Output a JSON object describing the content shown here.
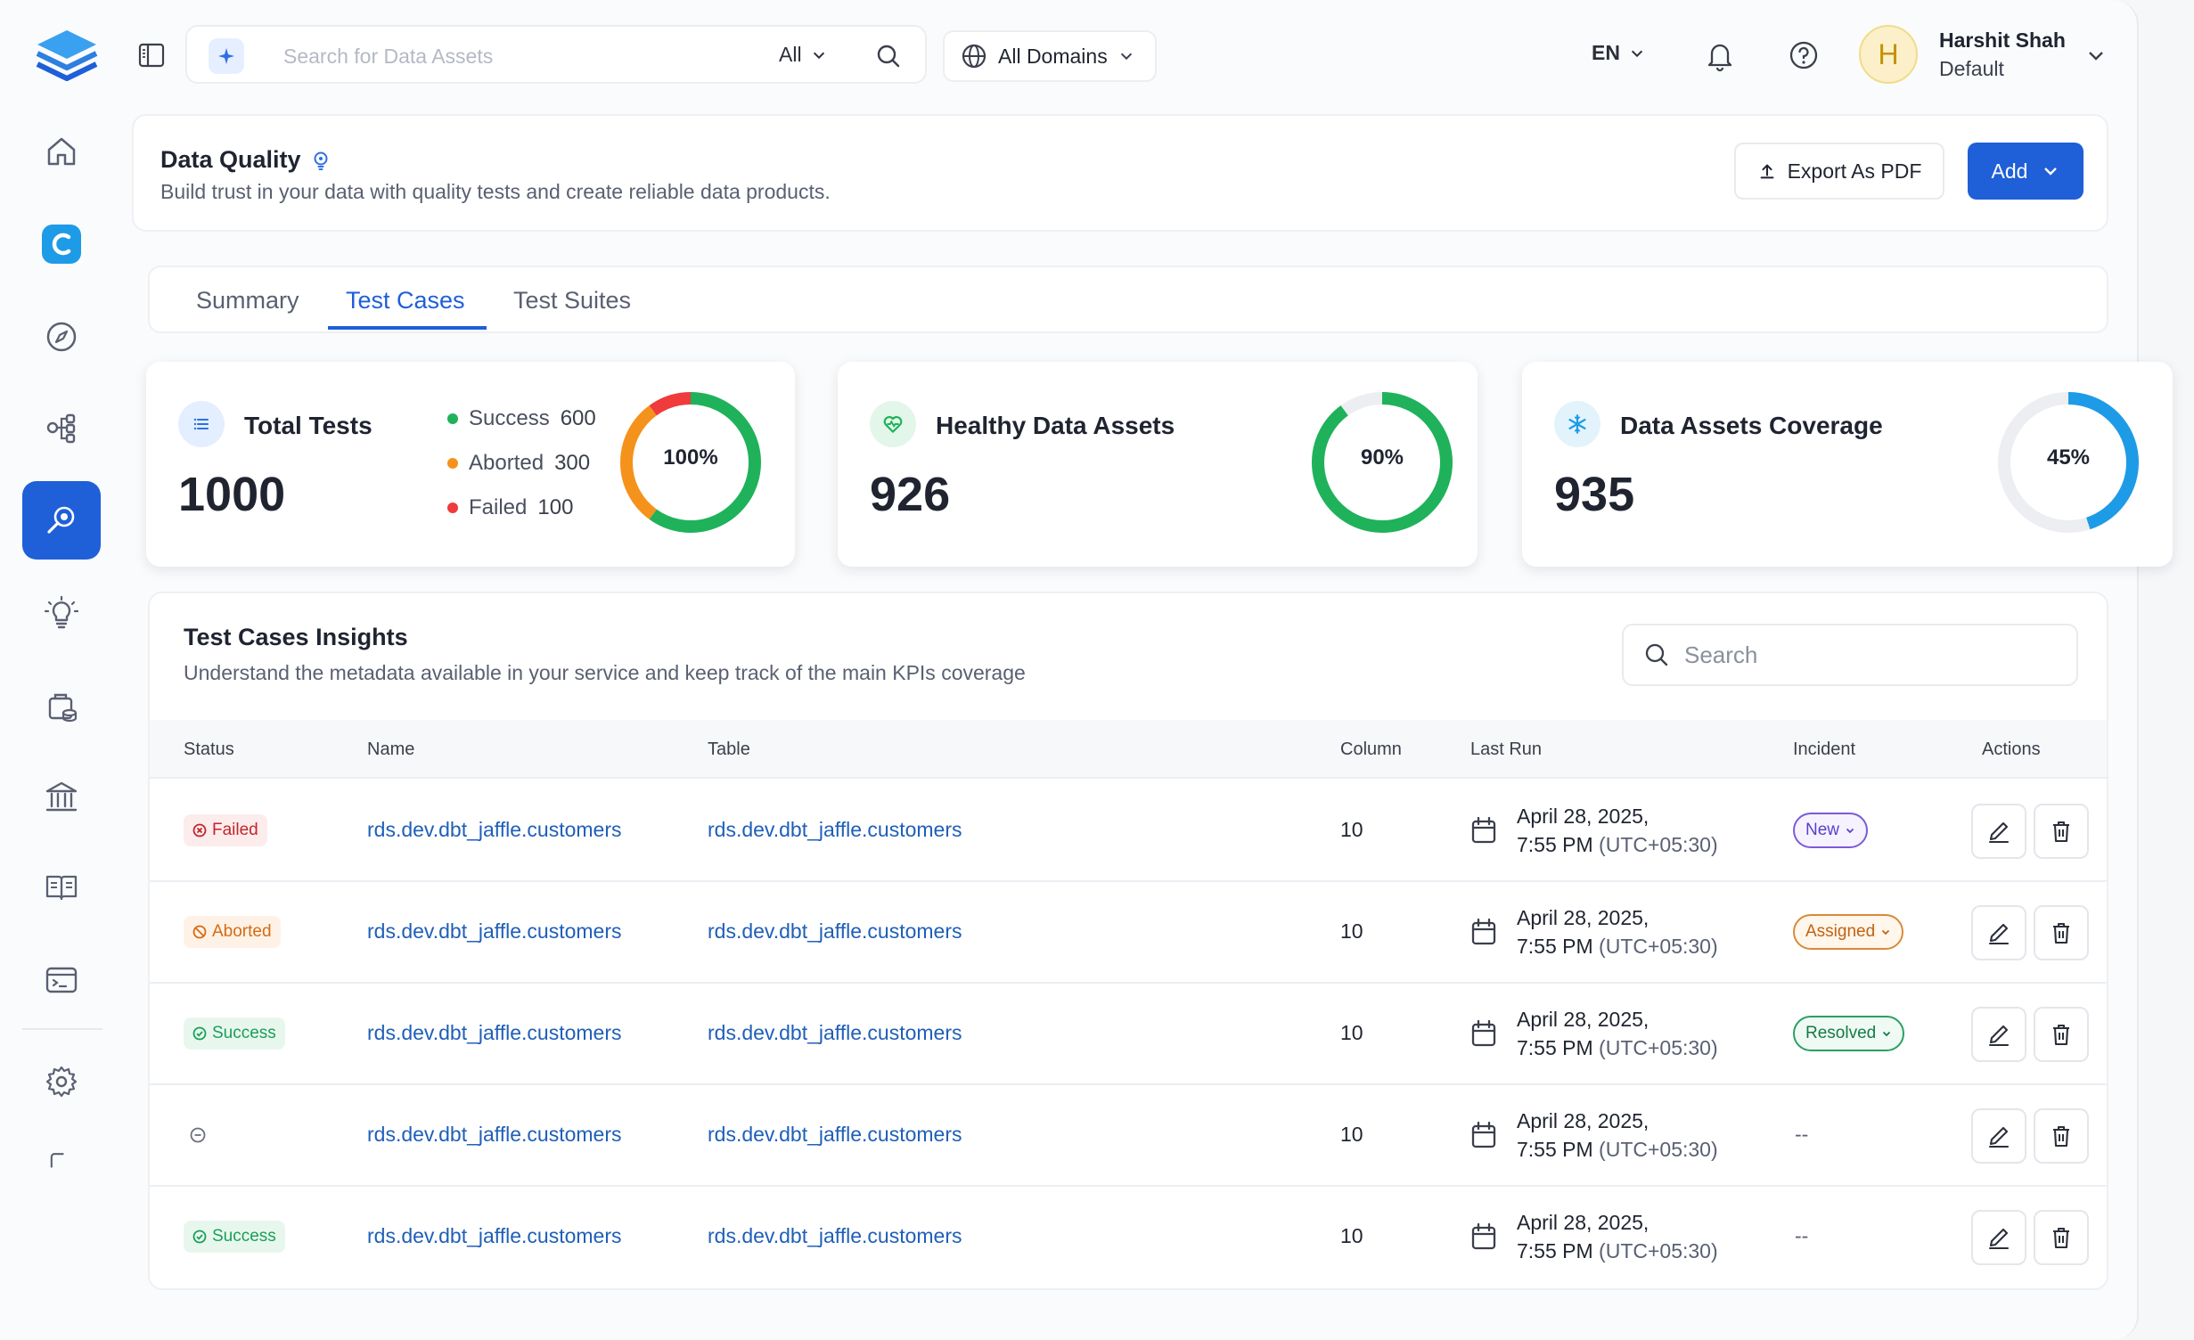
{
  "search": {
    "placeholder": "Search for Data Assets",
    "scope": "All"
  },
  "domains": {
    "label": "All Domains"
  },
  "language": "EN",
  "user": {
    "initial": "H",
    "name": "Harshit Shah",
    "role": "Default"
  },
  "page": {
    "title": "Data Quality",
    "subtitle": "Build trust in your data with quality tests and create reliable data products.",
    "export_label": "Export As PDF",
    "add_label": "Add"
  },
  "tabs": [
    {
      "label": "Summary"
    },
    {
      "label": "Test Cases"
    },
    {
      "label": "Test Suites"
    }
  ],
  "active_tab": "Test Cases",
  "cards": {
    "total": {
      "title": "Total Tests",
      "value": "1000",
      "donut_label": "100%",
      "legend": [
        {
          "label": "Success",
          "value": "600",
          "color": "#1fb25a"
        },
        {
          "label": "Aborted",
          "value": "300",
          "color": "#f5921b"
        },
        {
          "label": "Failed",
          "value": "100",
          "color": "#ef3b3b"
        }
      ]
    },
    "healthy": {
      "title": "Healthy Data Assets",
      "value": "926",
      "donut_label": "90%",
      "percent": 90,
      "color": "#1fb25a"
    },
    "coverage": {
      "title": "Data Assets Coverage",
      "value": "935",
      "donut_label": "45%",
      "percent": 45,
      "color": "#1e9be6"
    }
  },
  "insights": {
    "title": "Test Cases Insights",
    "subtitle": "Understand the metadata available in your service and keep track of the main KPIs coverage",
    "search_placeholder": "Search",
    "columns": [
      "Status",
      "Name",
      "Table",
      "Column",
      "Last Run",
      "Incident",
      "Actions"
    ],
    "rows": [
      {
        "status": "Failed",
        "name": "rds.dev.dbt_jaffle.customers",
        "table": "rds.dev.dbt_jaffle.customers",
        "column": "10",
        "date": "April 28, 2025,",
        "time": "7:55 PM",
        "tz": "(UTC+05:30)",
        "incident": "New"
      },
      {
        "status": "Aborted",
        "name": "rds.dev.dbt_jaffle.customers",
        "table": "rds.dev.dbt_jaffle.customers",
        "column": "10",
        "date": "April 28, 2025,",
        "time": "7:55 PM",
        "tz": "(UTC+05:30)",
        "incident": "Assigned"
      },
      {
        "status": "Success",
        "name": "rds.dev.dbt_jaffle.customers",
        "table": "rds.dev.dbt_jaffle.customers",
        "column": "10",
        "date": "April 28, 2025,",
        "time": "7:55 PM",
        "tz": "(UTC+05:30)",
        "incident": "Resolved"
      },
      {
        "status": "",
        "name": "rds.dev.dbt_jaffle.customers",
        "table": "rds.dev.dbt_jaffle.customers",
        "column": "10",
        "date": "April 28, 2025,",
        "time": "7:55 PM",
        "tz": "(UTC+05:30)",
        "incident": "--"
      },
      {
        "status": "Success",
        "name": "rds.dev.dbt_jaffle.customers",
        "table": "rds.dev.dbt_jaffle.customers",
        "column": "10",
        "date": "April 28, 2025,",
        "time": "7:55 PM",
        "tz": "(UTC+05:30)",
        "incident": "--"
      }
    ]
  },
  "colors": {
    "accent": "#1f5fd8",
    "success": "#1fb25a",
    "aborted": "#f5921b",
    "failed": "#ef3b3b",
    "coverage": "#1e9be6"
  },
  "sidebar": {
    "items": [
      {
        "icon": "home-icon"
      },
      {
        "icon": "collate-app-icon"
      },
      {
        "icon": "explore-compass-icon"
      },
      {
        "icon": "lineage-icon"
      },
      {
        "icon": "data-quality-icon",
        "active": true
      },
      {
        "icon": "insights-bulb-icon"
      },
      {
        "icon": "data-products-icon"
      },
      {
        "icon": "governance-icon"
      },
      {
        "icon": "glossary-book-icon"
      },
      {
        "icon": "terminal-icon"
      },
      {
        "icon": "settings-gear-icon"
      }
    ]
  }
}
